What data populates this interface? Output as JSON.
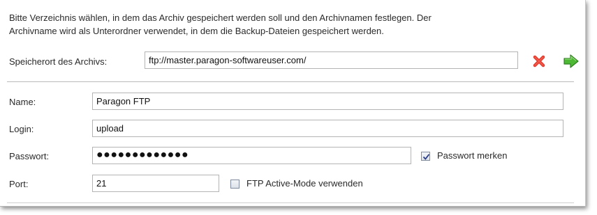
{
  "intro": {
    "line1": "Bitte Verzeichnis wählen, in dem das Archiv gespeichert werden soll und den Archivnamen festlegen. Der",
    "line2": "Archivname wird als Unterordner verwendet, in dem die Backup-Dateien gespeichert werden."
  },
  "location": {
    "label": "Speicherort des Archivs:",
    "value": "ftp://master.paragon-softwareuser.com/",
    "clear_icon": "red-x-icon",
    "go_icon": "green-arrow-right-icon",
    "clear_color": "#e23b2e",
    "go_color": "#3fae2a"
  },
  "form": {
    "name": {
      "label": "Name:",
      "value": "Paragon FTP"
    },
    "login": {
      "label": "Login:",
      "value": "upload"
    },
    "password": {
      "label": "Passwort:",
      "value": "●●●●●●●●●●●●●"
    },
    "remember": {
      "label": "Passwort merken",
      "checked": true
    },
    "port": {
      "label": "Port:",
      "value": "21"
    },
    "active_mode": {
      "label": "FTP Active-Mode verwenden",
      "checked": false
    }
  }
}
